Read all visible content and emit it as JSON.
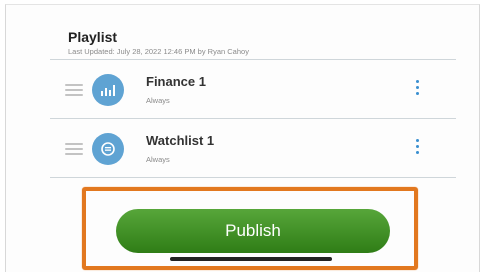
{
  "playlist": {
    "title": "Playlist",
    "last_updated": "Last Updated: July 28, 2022 12:46 PM by Ryan Cahoy"
  },
  "items": [
    {
      "name": "Finance 1",
      "subtitle": "Always",
      "icon": "chart-icon"
    },
    {
      "name": "Watchlist 1",
      "subtitle": "Always",
      "icon": "watchlist-icon"
    }
  ],
  "publish": {
    "label": "Publish"
  },
  "colors": {
    "accent": "#3a8fd0",
    "publish_green": "#3f8f22",
    "highlight": "#e2781f",
    "avatar": "#5fa3d3"
  }
}
